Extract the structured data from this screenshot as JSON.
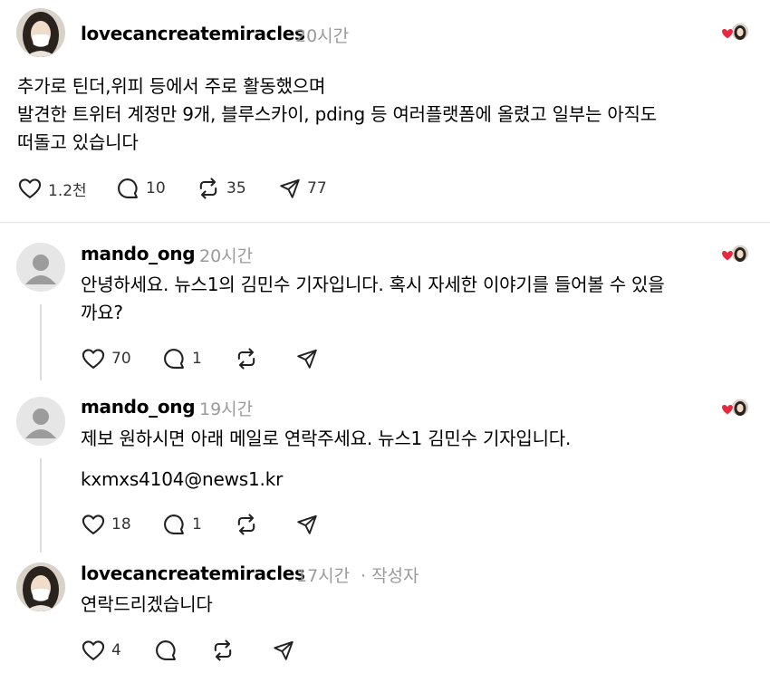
{
  "accent": "#e8283e",
  "posts": [
    {
      "username": "lovecancreatemiracles",
      "time": "20시간",
      "avatar": "profile-photo",
      "lines": [
        "추가로 틴더,위피 등에서 주로 활동했으며",
        "발견한 트위터 계정만 9개, 블루스카이, pding 등 여러플랫폼에 올렸고 일부는 아직도",
        "떠돌고 있습니다"
      ],
      "likes": "1.2천",
      "replies": "10",
      "reposts": "35",
      "shares": "77"
    },
    {
      "username": "mando_ong",
      "time": "20시간",
      "avatar": "default-user",
      "lines": [
        "안녕하세요. 뉴스1의 김민수 기자입니다. 혹시 자세한 이야기를 들어볼 수 있을",
        "까요?"
      ],
      "likes": "70",
      "replies": "1"
    },
    {
      "username": "mando_ong",
      "time": "19시간",
      "avatar": "default-user",
      "lines": [
        "제보 원하시면 아래 메일로 연락주세요. 뉴스1 김민수 기자입니다."
      ],
      "email": "kxmxs4104@news1.kr",
      "likes": "18",
      "replies": "1"
    },
    {
      "username": "lovecancreatemiracles",
      "time": "17시간",
      "author_tag": "· 작성자",
      "avatar": "profile-photo",
      "lines": [
        "연락드리겠습니다"
      ],
      "likes": "4"
    }
  ]
}
